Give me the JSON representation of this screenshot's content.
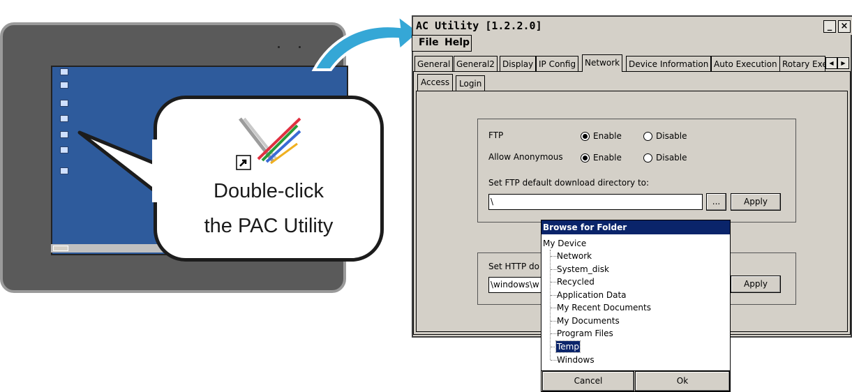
{
  "callout": {
    "line1": "Double-click",
    "line2": "the PAC Utility"
  },
  "window": {
    "title": "AC Utility  [1.2.2.0]",
    "minimize": "_",
    "close": "×",
    "menu": [
      "File",
      "Help"
    ],
    "tabs": [
      "General",
      "General2",
      "Display",
      "IP Config",
      "Network",
      "Device Information",
      "Auto Execution",
      "Rotary Exe"
    ],
    "scroll_left": "◀",
    "scroll_right": "▶",
    "subtabs": [
      "Access",
      "Login"
    ],
    "ftp": {
      "ftp_label": "FTP",
      "anon_label": "Allow Anonymous",
      "enable": "Enable",
      "disable": "Disable",
      "dir_label": "Set FTP default download directory to:",
      "dir_value": "\\",
      "browse": "...",
      "apply": "Apply"
    },
    "http": {
      "label": "Set HTTP do",
      "value": "\\windows\\w",
      "apply": "Apply"
    }
  },
  "dialog": {
    "title": "Browse for Folder",
    "root": "My Device",
    "items": [
      "Network",
      "System_disk",
      "Recycled",
      "Application Data",
      "My Recent Documents",
      "My Documents",
      "Program Files",
      "Temp",
      "Windows"
    ],
    "selected": "Temp",
    "cancel": "Cancel",
    "ok": "Ok"
  },
  "colors": {
    "selection": "#0a246a",
    "arrow": "#35a7d6",
    "desktop": "#2e5b9c"
  }
}
